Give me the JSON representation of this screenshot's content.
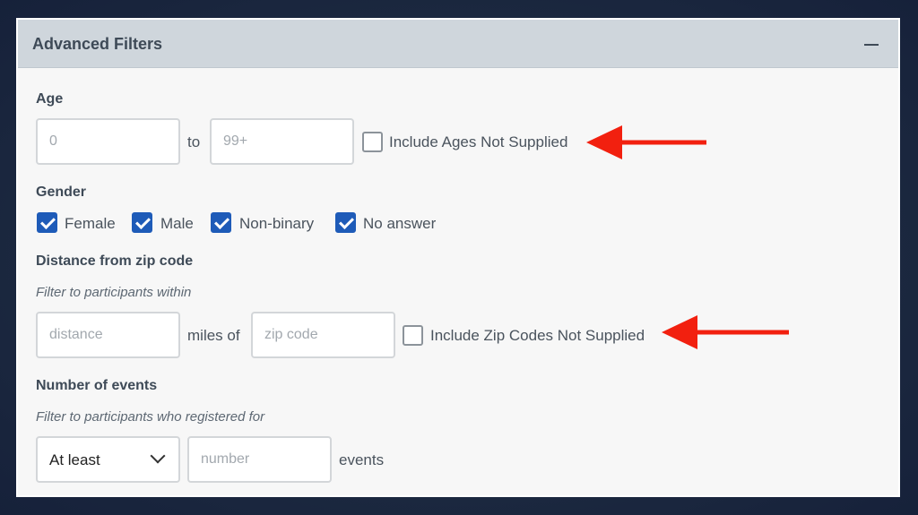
{
  "panel": {
    "title": "Advanced Filters"
  },
  "age": {
    "label": "Age",
    "min_placeholder": "0",
    "to_label": "to",
    "max_placeholder": "99+",
    "include_label": "Include Ages Not Supplied",
    "include_checked": false
  },
  "gender": {
    "label": "Gender",
    "options": [
      {
        "label": "Female",
        "checked": true
      },
      {
        "label": "Male",
        "checked": true
      },
      {
        "label": "Non-binary",
        "checked": true
      },
      {
        "label": "No answer",
        "checked": true
      }
    ]
  },
  "distance": {
    "label": "Distance from zip code",
    "hint": "Filter to participants within",
    "distance_placeholder": "distance",
    "miles_of_label": "miles of",
    "zip_placeholder": "zip code",
    "include_label": "Include Zip Codes Not Supplied",
    "include_checked": false
  },
  "events": {
    "label": "Number of events",
    "hint": "Filter to participants who registered for",
    "comparator": "At least",
    "number_placeholder": "number",
    "suffix": "events"
  },
  "colors": {
    "accent": "#1e5bb8",
    "arrow": "#f2200f",
    "header_bg": "#cfd6dc"
  },
  "icons": {
    "collapse": "minus-icon",
    "dropdown": "chevron-down-icon",
    "annotation": "arrow-left-icon"
  }
}
